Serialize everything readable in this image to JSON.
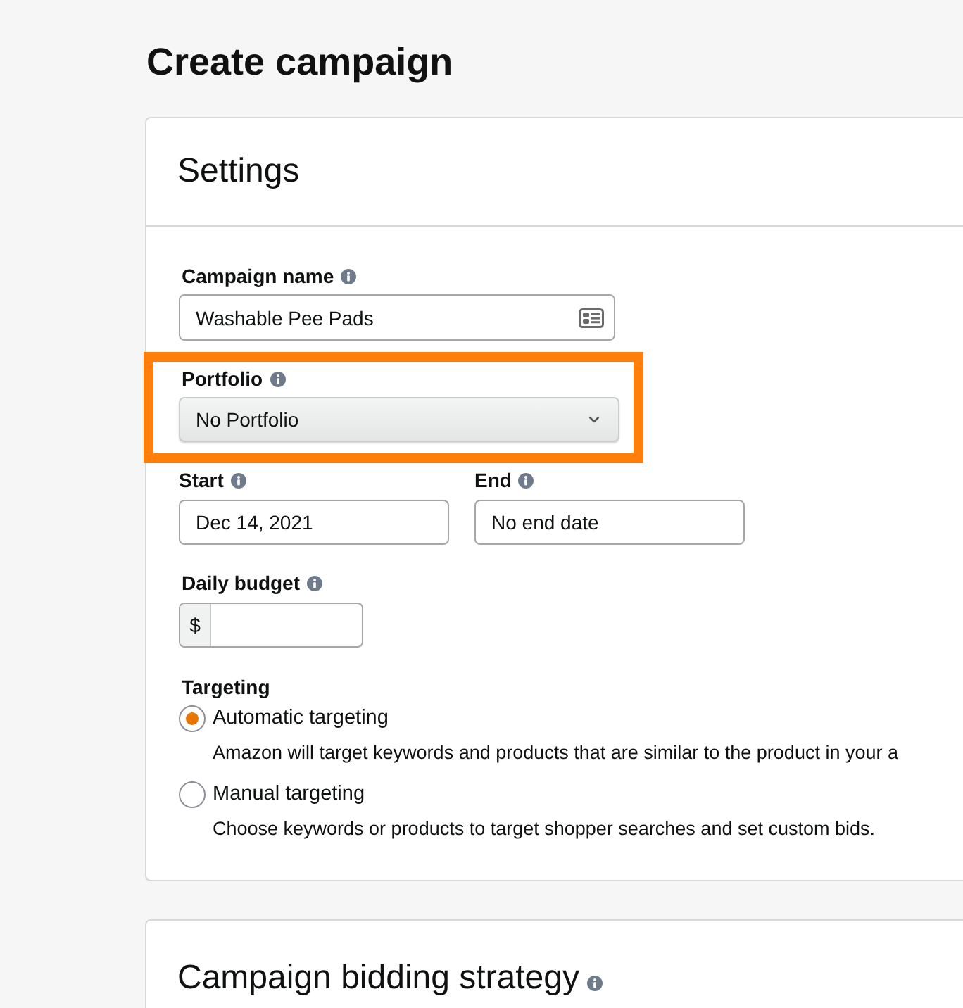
{
  "page": {
    "title": "Create campaign"
  },
  "settings": {
    "title": "Settings",
    "campaign_name": {
      "label": "Campaign name",
      "value": "Washable Pee Pads"
    },
    "portfolio": {
      "label": "Portfolio",
      "value": "No Portfolio",
      "highlighted": true
    },
    "start": {
      "label": "Start",
      "value": "Dec 14, 2021"
    },
    "end": {
      "label": "End",
      "value": "No end date"
    },
    "daily_budget": {
      "label": "Daily budget",
      "prefix": "$"
    },
    "targeting": {
      "label": "Targeting",
      "options": [
        {
          "label": "Automatic targeting",
          "description": "Amazon will target keywords and products that are similar to the product in your a",
          "selected": true
        },
        {
          "label": "Manual targeting",
          "description": "Choose keywords or products to target shopper searches and set custom bids.",
          "selected": false
        }
      ]
    }
  },
  "bidding_strategy": {
    "title": "Campaign bidding strategy"
  }
}
